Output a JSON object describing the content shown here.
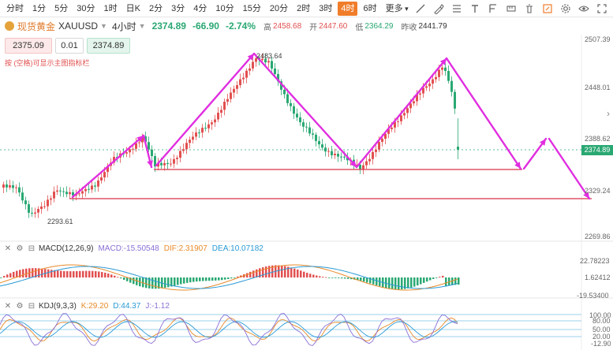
{
  "toolbar": {
    "timeframes": [
      "分时",
      "1分",
      "5分",
      "30分",
      "1时",
      "日K",
      "2分",
      "3分",
      "4分",
      "10分",
      "15分",
      "20分",
      "2时",
      "3时",
      "4时",
      "6时",
      "更多"
    ],
    "active_timeframe": "4时",
    "icons": [
      "trendline-icon",
      "brush-icon",
      "ruler-icon",
      "text-tool-icon",
      "fibonacci-icon",
      "measure-icon",
      "clear-icon",
      "drawing-mode-icon",
      "settings-icon",
      "eye-icon",
      "fullscreen-icon"
    ]
  },
  "header": {
    "name": "现货黄金",
    "symbol": "XAUUSD",
    "period": "4小时",
    "price": "2374.89",
    "change": "-66.90",
    "change_pct": "-2.74%",
    "high_label": "高",
    "high": "2458.68",
    "open_label": "开",
    "open": "2447.60",
    "low_label": "低",
    "low": "2364.29",
    "prev_close_label": "昨收",
    "prev_close": "2441.79"
  },
  "order": {
    "sell_price": "2375.09",
    "quantity": "0.01",
    "buy_price": "2374.89",
    "hint": "按 (空格)可显示主图指标栏"
  },
  "price_axis": {
    "labels": [
      "2507.39",
      "2448.01",
      "2388.62",
      "2329.24",
      "2269.86"
    ],
    "current": "2374.89"
  },
  "annotations": {
    "high_label": "2483.64",
    "low_label": "2293.61"
  },
  "macd": {
    "name": "MACD(12,26,9)",
    "macd_label": "MACD:",
    "macd_value": "-15.50548",
    "dif_label": "DIF:",
    "dif_value": "2.31907",
    "dea_label": "DEA:",
    "dea_value": "10.07182",
    "axis": [
      "22.78223",
      "1.62412",
      "-19.53400"
    ]
  },
  "kdj": {
    "name": "KDJ(9,3,3)",
    "k_label": "K:",
    "k_value": "29.20",
    "d_label": "D:",
    "d_value": "44.37",
    "j_label": "J:",
    "j_value": "-1.12",
    "axis": [
      "100.00",
      "80.00",
      "50.00",
      "20.00",
      "-12.90"
    ]
  },
  "colors": {
    "up": "#e25050",
    "down": "#2aa873",
    "drawing": "#e02ee0",
    "support": "#d9304a",
    "accent": "#f07d2a"
  }
}
